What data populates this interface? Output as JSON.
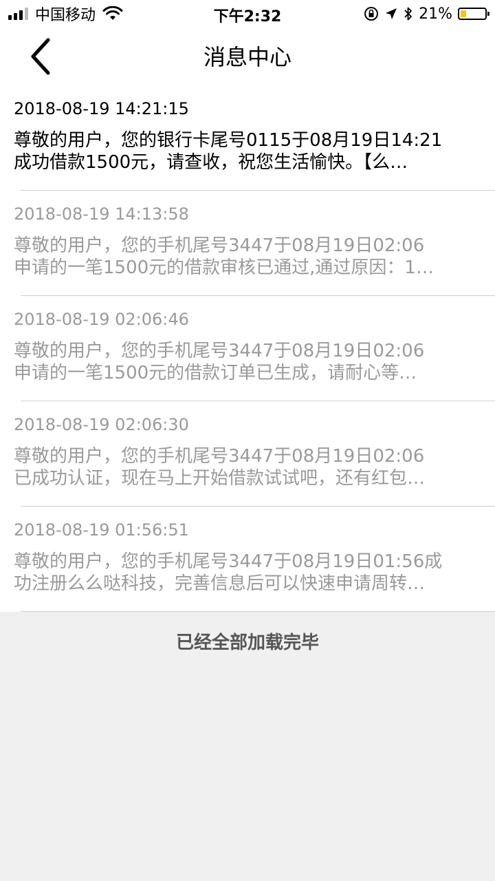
{
  "status_bar": {
    "carrier": "中国移动",
    "time": "下午2:32",
    "battery_percent": "21%"
  },
  "nav": {
    "title": "消息中心"
  },
  "messages": [
    {
      "time": "2018-08-19 14:21:15",
      "line1": "尊敬的用户，您的银行卡尾号0115于08月19日14:21",
      "line2": "成功借款1500元，请查收，祝您生活愉快。【么…",
      "unread": true
    },
    {
      "time": "2018-08-19 14:13:58",
      "line1": "尊敬的用户，您的手机尾号3447于08月19日02:06",
      "line2": "申请的一笔1500元的借款审核已通过,通过原因：1…",
      "unread": false
    },
    {
      "time": "2018-08-19 02:06:46",
      "line1": "尊敬的用户，您的手机尾号3447于08月19日02:06",
      "line2": "申请的一笔1500元的借款订单已生成，请耐心等…",
      "unread": false
    },
    {
      "time": "2018-08-19 02:06:30",
      "line1": "尊敬的用户，您的手机尾号3447于08月19日02:06",
      "line2": "已成功认证，现在马上开始借款试试吧，还有红包…",
      "unread": false
    },
    {
      "time": "2018-08-19 01:56:51",
      "line1": "尊敬的用户，您的手机尾号3447于08月19日01:56成",
      "line2": "功注册么么哒科技，完善信息后可以快速申请周转…",
      "unread": false
    }
  ],
  "footer": {
    "text": "已经全部加载完毕"
  },
  "colors": {
    "unread_text": "#000000",
    "read_text": "#9a9a9a",
    "background": "#f0f0f0",
    "battery_fill": "#f7c600"
  },
  "icons": {
    "back": "chevron-left-icon",
    "wifi": "wifi-icon",
    "signal": "signal-icon",
    "lock_rotation": "orientation-lock-icon",
    "location": "location-arrow-icon",
    "bluetooth": "bluetooth-icon",
    "battery": "battery-icon"
  }
}
